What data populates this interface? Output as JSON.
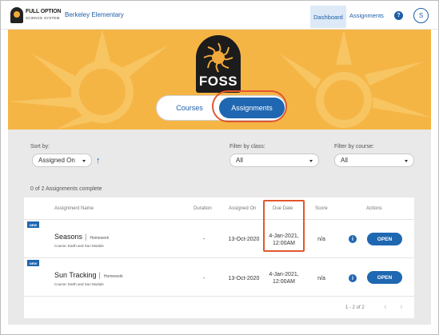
{
  "header": {
    "logo_line1": "FULL OPTION",
    "logo_line2": "SCIENCE SYSTEM",
    "school": "Berkeley Elementary",
    "nav_dashboard": "Dashboard",
    "nav_assignments": "Assignments",
    "help_label": "?",
    "user_initial": "S"
  },
  "banner": {
    "brand": "FOSS",
    "toggle_courses": "Courses",
    "toggle_assignments": "Assignments"
  },
  "filters": {
    "sort_label": "Sort by:",
    "sort_value": "Assigned On",
    "class_label": "Filter by class:",
    "class_value": "All",
    "course_label": "Filter by course:",
    "course_value": "All",
    "complete_text": "0 of 2 Assignments complete"
  },
  "table": {
    "headers": {
      "name": "Assignment Name",
      "duration": "Duration",
      "assigned": "Assigned On",
      "due": "Due Date",
      "score": "Score",
      "actions": "Actions"
    },
    "rows": [
      {
        "badge": "NEW",
        "title": "Seasons",
        "type": "Homework",
        "course": "Course: Earth and Sun Module",
        "duration": "-",
        "assigned": "13-Oct-2020",
        "due_line1": "4-Jan-2021,",
        "due_line2": "12:00AM",
        "score": "n/a",
        "info": "i",
        "action": "OPEN"
      },
      {
        "badge": "NEW",
        "title": "Sun Tracking",
        "type": "Homework",
        "course": "Course: Earth and Sun Module",
        "duration": "-",
        "assigned": "13-Oct-2020",
        "due_line1": "4-Jan-2021,",
        "due_line2": "12:00AM",
        "score": "n/a",
        "info": "i",
        "action": "OPEN"
      }
    ],
    "pagination": "1 - 2 of 2",
    "prev": "‹",
    "next": "›"
  },
  "colors": {
    "primary": "#1f67b1",
    "banner": "#f5b545",
    "highlight": "#e2572f"
  },
  "icons": {
    "help": "question-circle-icon",
    "sort": "arrow-up-icon",
    "info": "info-circle-icon",
    "caret": "chevron-down-icon"
  }
}
